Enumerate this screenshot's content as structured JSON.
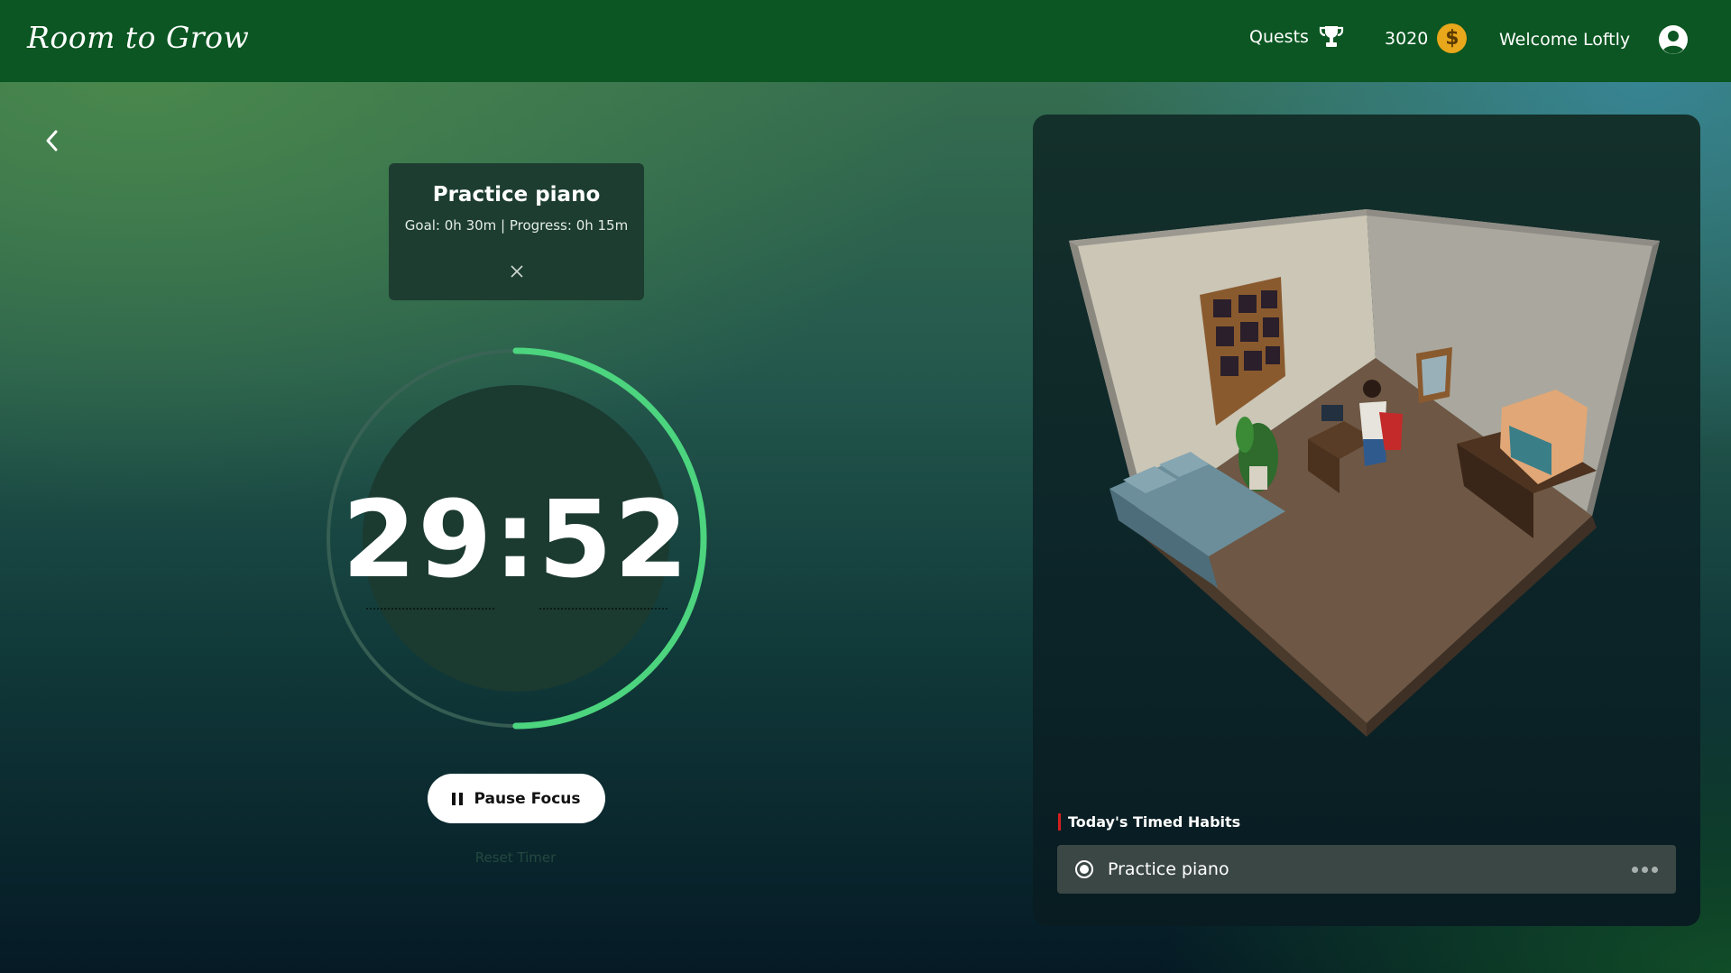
{
  "app": {
    "title": "Room to Grow"
  },
  "nav": {
    "quests_label": "Quests",
    "coins": "3020",
    "coin_symbol": "$",
    "welcome": "Welcome Loftly"
  },
  "focus_card": {
    "title": "Practice piano",
    "goal_progress": "Goal: 0h 30m | Progress: 0h 15m"
  },
  "timer": {
    "display": "29:52",
    "progress_fraction": 0.5
  },
  "controls": {
    "pause_label": "Pause Focus",
    "reset_label": "Reset Timer"
  },
  "room": {
    "habits_heading": "Today's Timed Habits",
    "habits": [
      {
        "label": "Practice piano"
      }
    ]
  },
  "colors": {
    "topbar": "#0b5622",
    "accent_ring": "#4cd47e",
    "coin": "#e9a71b",
    "heading_bar": "#d41f1f"
  }
}
